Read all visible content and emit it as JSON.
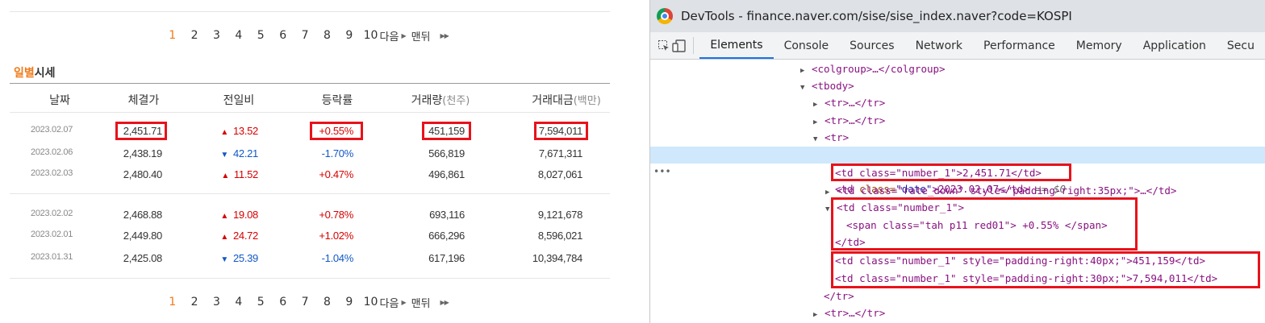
{
  "page": {
    "pagination": {
      "pages": [
        "1",
        "2",
        "3",
        "4",
        "5",
        "6",
        "7",
        "8",
        "9",
        "10"
      ],
      "current": "1",
      "next_label": "다음",
      "last_label": "맨뒤"
    },
    "section_title_a": "일별",
    "section_title_b": "시세",
    "headers": {
      "date": "날짜",
      "close": "체결가",
      "change": "전일비",
      "rate": "등락률",
      "volume": "거래량",
      "volume_unit": "(천주)",
      "amount": "거래대금",
      "amount_unit": "(백만)"
    },
    "rows": [
      {
        "date": "2023.02.07",
        "close": "2,451.71",
        "dir": "up",
        "change": "13.52",
        "rate": "+0.55%",
        "volume": "451,159",
        "amount": "7,594,011"
      },
      {
        "date": "2023.02.06",
        "close": "2,438.19",
        "dir": "down",
        "change": "42.21",
        "rate": "-1.70%",
        "volume": "566,819",
        "amount": "7,671,311"
      },
      {
        "date": "2023.02.03",
        "close": "2,480.40",
        "dir": "up",
        "change": "11.52",
        "rate": "+0.47%",
        "volume": "496,861",
        "amount": "8,027,061"
      },
      {
        "date": "2023.02.02",
        "close": "2,468.88",
        "dir": "up",
        "change": "19.08",
        "rate": "+0.78%",
        "volume": "693,116",
        "amount": "9,121,678"
      },
      {
        "date": "2023.02.01",
        "close": "2,449.80",
        "dir": "up",
        "change": "24.72",
        "rate": "+1.02%",
        "volume": "666,296",
        "amount": "8,596,021"
      },
      {
        "date": "2023.01.31",
        "close": "2,425.08",
        "dir": "down",
        "change": "25.39",
        "rate": "-1.04%",
        "volume": "617,196",
        "amount": "10,394,784"
      }
    ],
    "up_arrow": "▲",
    "down_arrow": "▼",
    "accent_orange": "#f07a1a",
    "up_color": "#d60000",
    "down_color": "#1158c7",
    "highlight_color": "#e8121b"
  },
  "devtools": {
    "title": "DevTools - finance.naver.com/sise/sise_index.naver?code=KOSPI",
    "tabs": [
      "Elements",
      "Console",
      "Sources",
      "Network",
      "Performance",
      "Memory",
      "Application",
      "Secu"
    ],
    "active_tab": "Elements",
    "icons": [
      "inspect-icon",
      "device-toggle-icon"
    ],
    "lines": {
      "colgroup": "<colgroup>…</colgroup>",
      "tbody_open": "<tbody>",
      "tr_collapsed_1": "<tr>…</tr>",
      "tr_collapsed_2": "<tr>…</tr>",
      "tr_open": "<tr>",
      "td_date_open": "<td ",
      "td_date_attr": "class=",
      "td_date_val": "\"date\"",
      "td_date_text": ">2023.02.07</td>",
      "td_date_suffix": " == $0",
      "td_close": "<td class=\"number_1\">2,451.71</td>",
      "td_rate_down": "<td class=\"rate_down\" style=\"padding-right:35px;\">…</td>",
      "td_num_open": "<td class=\"number_1\">",
      "span_line": "<span class=\"tah p11 red01\"> +0.55% </span>",
      "td_close_tag": "</td>",
      "td_vol": "<td class=\"number_1\" style=\"padding-right:40px;\">451,159</td>",
      "td_amt": "<td class=\"number_1\" style=\"padding-right:30px;\">7,594,011</td>",
      "tr_close": "</tr>",
      "tr_collapsed_3": "<tr>…</tr>"
    }
  }
}
